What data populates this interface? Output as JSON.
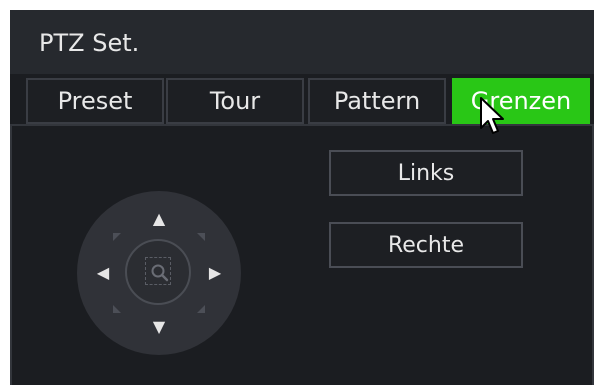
{
  "window": {
    "title": "PTZ Set."
  },
  "tabs": [
    {
      "label": "Preset",
      "active": false
    },
    {
      "label": "Tour",
      "active": false
    },
    {
      "label": "Pattern",
      "active": false
    },
    {
      "label": "Grenzen",
      "active": true
    }
  ],
  "buttons": {
    "left_label": "Links",
    "right_label": "Rechte"
  },
  "ptz_control": {
    "icons": [
      "arrow-up-icon",
      "arrow-down-icon",
      "arrow-left-icon",
      "arrow-right-icon",
      "zoom-icon"
    ]
  },
  "colors": {
    "accent": "#29c716",
    "background": "#1b1d21",
    "titlebar": "#26292e"
  }
}
